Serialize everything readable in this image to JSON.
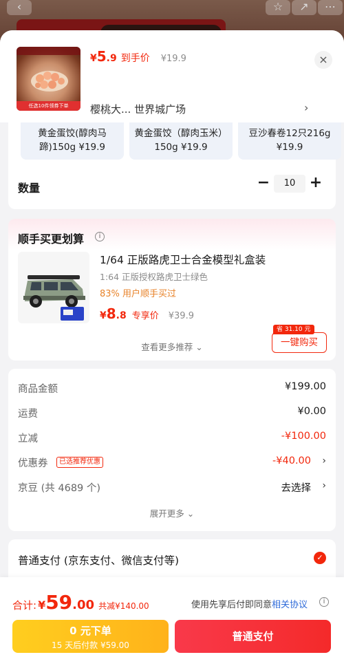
{
  "background": {
    "back_icon": "back-arrow-icon",
    "star_icon": "star-icon",
    "share_icon": "share-icon",
    "more_icon": "more-icon"
  },
  "product": {
    "price_symbol": "¥",
    "price_int": "5",
    "price_dec": ".9",
    "price_tag": "到手价",
    "original_price": "¥19.9",
    "store": "樱桃大... 世界城广场",
    "thumb_band": "任选10件领券下单"
  },
  "variants": [
    {
      "label": "黄金蛋饺(醇肉马蹄)150g ¥19.9"
    },
    {
      "label": "黄金蛋饺（醇肉玉米）150g ¥19.9"
    },
    {
      "label": "豆沙春卷12只216g ¥19.9"
    }
  ],
  "quantity": {
    "label": "数量",
    "minus": "−",
    "value": "10",
    "plus": "+"
  },
  "recommend": {
    "title": "顺手买更划算",
    "info": "i",
    "name": "1/64 正版路虎卫士合金模型礼盒装",
    "subtitle": "1:64 正版授权路虎卫士绿色",
    "percent": "83% 用户顺手买过",
    "price_symbol": "¥",
    "price_int": "8",
    "price_dec": ".8",
    "price_tag": "专享价",
    "original_price": "¥39.9",
    "save_badge": "省 31.10 元",
    "buy_label": "一键购买",
    "more_label": "查看更多推荐 ⌄"
  },
  "amounts": {
    "rows": [
      {
        "label": "商品金额",
        "value": "¥199.00"
      },
      {
        "label": "运费",
        "value": "¥0.00"
      },
      {
        "label": "立减",
        "value": "-¥100.00"
      },
      {
        "label": "优惠券",
        "tag": "已选推荐优惠",
        "value": "-¥40.00",
        "chevron": "›"
      },
      {
        "label": "京豆 (共 4689 个)",
        "value": "去选择",
        "chevron": "›"
      }
    ],
    "expand_label": "展开更多 ⌄"
  },
  "payment": {
    "label": "普通支付 (京东支付、微信支付等)",
    "check": "✓"
  },
  "bottom": {
    "total_label": "合计:",
    "total_symbol": "¥",
    "total_int": "59",
    "total_dec": ".00",
    "saved": "共减¥140.00",
    "agree_text": "使用先享后付即同意",
    "agree_link": "相关协议",
    "agree_info": "i",
    "later_main": "0 元下单",
    "later_sub": "15 天后付款 ¥59.00",
    "pay_label": "普通支付"
  },
  "colors": {
    "accent_red": "#f2270c",
    "link_blue": "#2f6bd9",
    "later_yellow": "#ffbe1d"
  }
}
